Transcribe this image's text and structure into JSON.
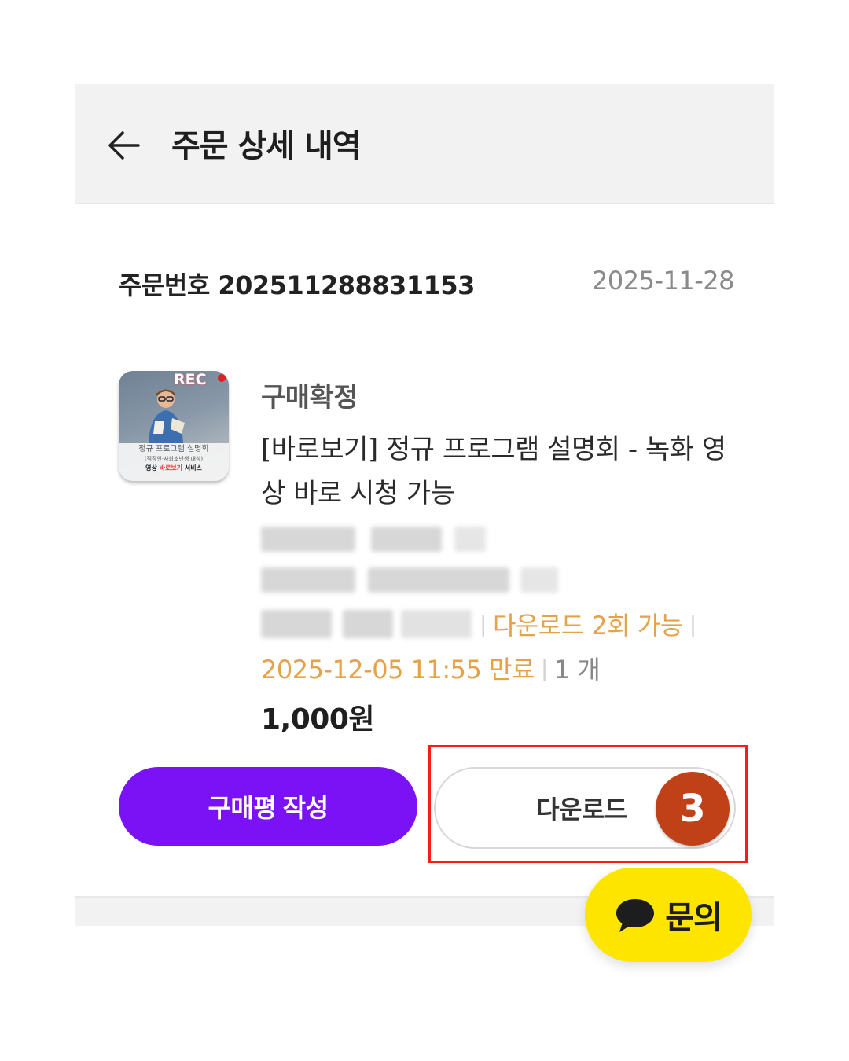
{
  "header": {
    "title": "주문 상세 내역",
    "back_icon": "arrow-left-icon"
  },
  "order": {
    "number_label": "주문번호 202511288831153",
    "date": "2025-11-28"
  },
  "product": {
    "thumbnail": {
      "rec_label": "REC",
      "caption_line1": "정규 프로그램 설명회",
      "caption_line2": "(직장인·사회초년생 대상)",
      "caption_line3a": "영상 ",
      "caption_line3b": "바로보기",
      "caption_line3c": " 서비스"
    },
    "status": "구매확정",
    "title": "[바로보기] 정규 프로그램 설명회 - 녹화 영상 바로 시청 가능",
    "download_limit": "다운로드 2회 가능",
    "expiry": "2025-12-05 11:55 만료",
    "quantity": "1 개",
    "price": "1,000원"
  },
  "actions": {
    "review_button": "구매평 작성",
    "download_button": "다운로드",
    "step_badge": "3"
  },
  "chat": {
    "label": "문의",
    "icon": "chat-bubble-icon"
  },
  "colors": {
    "review_button": "#7a12f5",
    "chat_button": "#fee500",
    "highlight_box": "#ff1a1a",
    "step_badge": "#c04018",
    "option_text": "#e4a24a"
  }
}
